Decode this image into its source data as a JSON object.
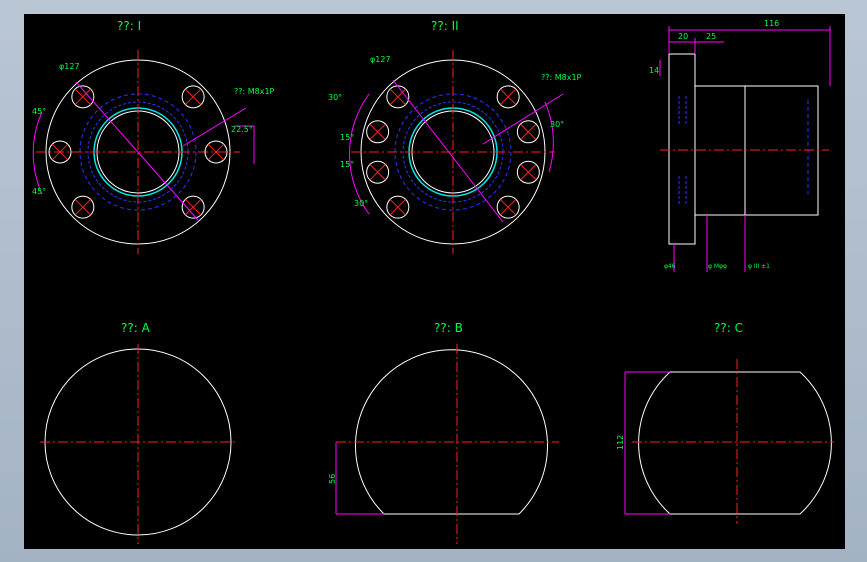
{
  "colors": {
    "frame": "#a9b8c8",
    "background": "#000000",
    "outline": "#ffffff",
    "centerline": "#ff2020",
    "hidden": "#2a36ff",
    "dimension": "#ff00ff",
    "text": "#00ff40",
    "thread": "#00e5e5"
  },
  "views": {
    "view1_title": "??: I",
    "view2_title": "??: II",
    "viewA_title": "??: A",
    "viewB_title": "??: B",
    "viewC_title": "??: C"
  },
  "view1": {
    "dia": "φ127",
    "thread": "??: M8x1P",
    "angle_upper": "45°",
    "angle_lower": "45°",
    "angle_right": "22.5°"
  },
  "view2": {
    "dia": "φ127",
    "thread": "??: M8x1P",
    "angle_1": "30°",
    "angle_2": "15°",
    "angle_3": "15°",
    "angle_4": "30°",
    "angle_right": "30°"
  },
  "side": {
    "total": "116",
    "d1": "20",
    "d2": "25",
    "thick": "14",
    "dia_a": "φ46",
    "dia_b": "φ Mφφ",
    "dia_c": "φ III  ±1"
  },
  "viewB": {
    "height": "56"
  },
  "viewC": {
    "width": "112"
  }
}
